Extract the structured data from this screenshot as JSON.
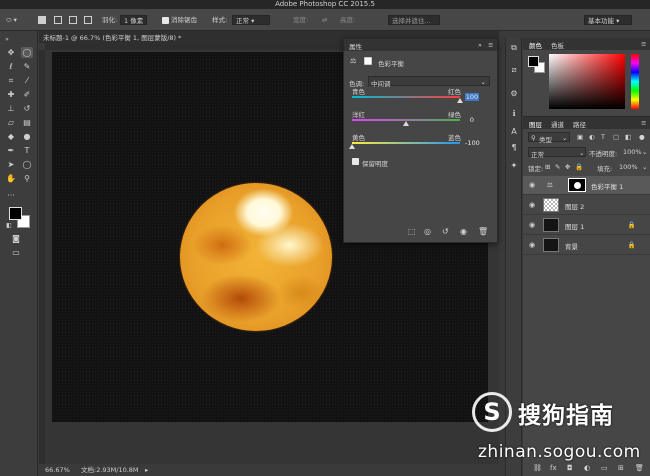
{
  "app": {
    "title": "Adobe Photoshop CC 2015.5"
  },
  "options_bar": {
    "feather_label": "羽化:",
    "feather_value": "1 像素",
    "antialias_label": "消除锯齿",
    "style_label": "样式:",
    "style_value": "正常",
    "width_label": "宽度:",
    "height_label": "高度:",
    "select_mask_button": "选择并遮住...",
    "workspace": "基本功能"
  },
  "document": {
    "tab_title": "未标题-1 @ 66.7% (色彩平衡 1, 图层蒙版/8) *",
    "zoom": "66.67%",
    "doc_info": "文档:2.93M/10.8M"
  },
  "properties_panel": {
    "title": "属性",
    "adjustment_name": "色彩平衡",
    "tone_label": "色调:",
    "tone_value": "中间调",
    "sliders": [
      {
        "left": "青色",
        "right": "红色",
        "value": "100",
        "fraction": 1.0,
        "gradient": [
          "#00bcd4",
          "#ff3b3b"
        ]
      },
      {
        "left": "洋红",
        "right": "绿色",
        "value": "0",
        "fraction": 0.5,
        "gradient": [
          "#e040fb",
          "#4caf50"
        ]
      },
      {
        "left": "黄色",
        "right": "蓝色",
        "value": "-100",
        "fraction": 0.0,
        "gradient": [
          "#ffeb3b",
          "#2196f3"
        ]
      }
    ],
    "preserve_luminosity": "保留明度"
  },
  "color_panel": {
    "tabs": [
      "颜色",
      "色板"
    ],
    "foreground": "#000000",
    "background": "#ffffff",
    "hue_color": "#ff0000"
  },
  "layers_panel": {
    "tabs": [
      "图层",
      "通道",
      "路径"
    ],
    "filter_label": "类型",
    "blend_mode": "正常",
    "opacity_label": "不透明度:",
    "opacity_value": "100%",
    "lock_label": "锁定:",
    "fill_label": "填充:",
    "fill_value": "100%",
    "layers": [
      {
        "name": "色彩平衡 1",
        "kind": "adjustment",
        "locked": false
      },
      {
        "name": "图层 2",
        "kind": "transparent",
        "locked": false
      },
      {
        "name": "图层 1",
        "kind": "dark",
        "locked": true
      },
      {
        "name": "背景",
        "kind": "dark",
        "locked": true
      }
    ],
    "footer_icons": [
      "link-icon",
      "fx-icon",
      "mask-icon",
      "adjustment-icon",
      "folder-icon",
      "new-layer-icon",
      "trash-icon"
    ]
  },
  "watermark": {
    "logo_letter": "S",
    "brand": "搜狗指南",
    "url": "zhinan.sogou.com"
  }
}
